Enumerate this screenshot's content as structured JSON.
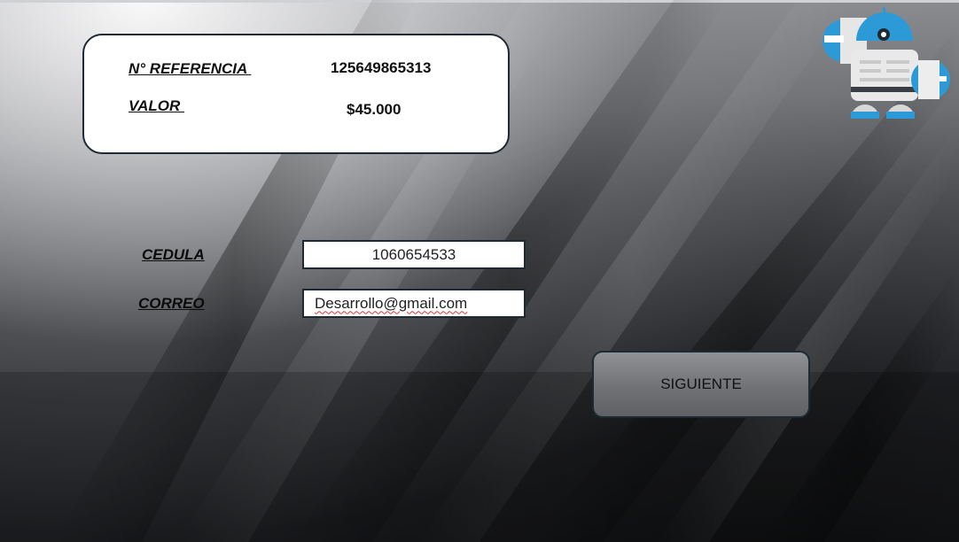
{
  "info_card": {
    "reference_label": "N° REFERENCIA ",
    "reference_value": "125649865313",
    "amount_label": "VALOR ",
    "amount_value": "$45.000"
  },
  "form": {
    "cedula_label": "CEDULA",
    "cedula_value": "1060654533",
    "correo_label": "CORREO",
    "correo_value": "Desarrollo@gmail.com"
  },
  "next_button": {
    "label": "SIGUIENTE"
  },
  "logo": {
    "icon": "robot-logo-icon",
    "accent_color": "#2b9ad6"
  },
  "colors": {
    "card_border": "#1e2a33",
    "button_fill": "#707276"
  }
}
